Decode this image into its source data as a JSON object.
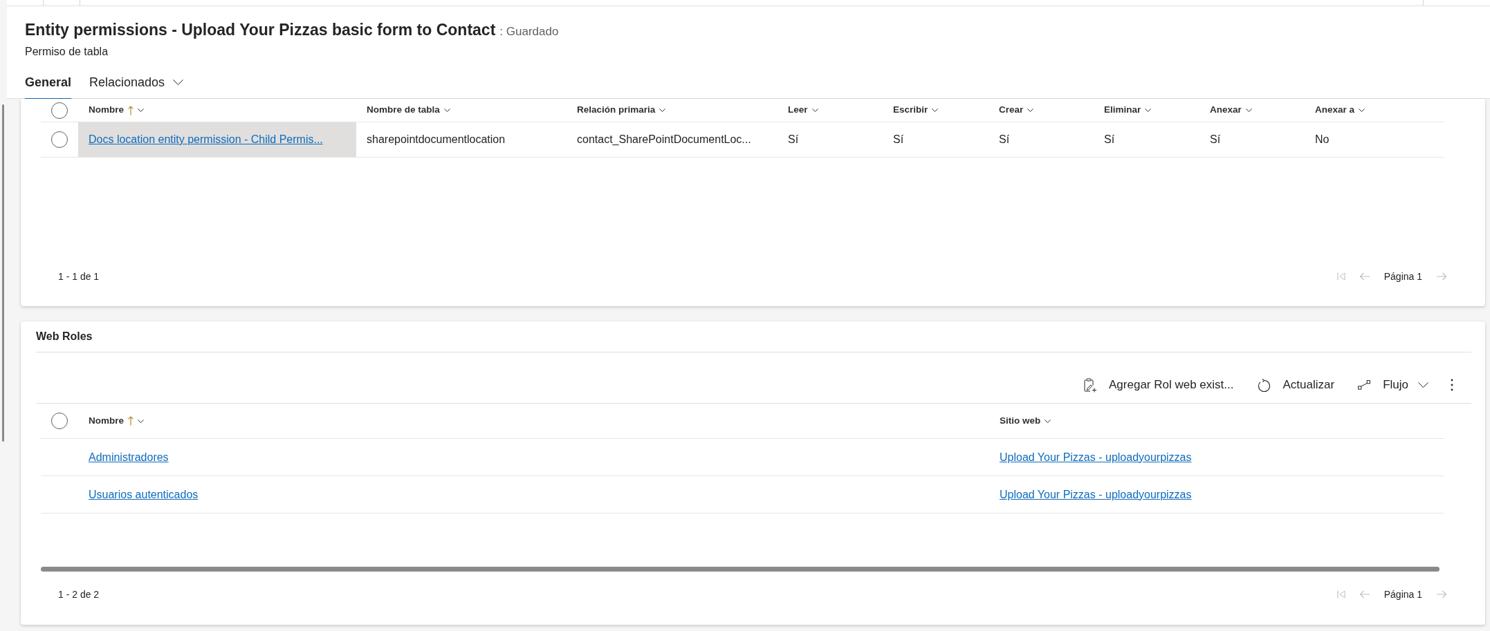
{
  "header": {
    "title": "Entity permissions - Upload Your Pizzas basic form to Contact",
    "status": ": Guardado",
    "subtitle": "Permiso de tabla"
  },
  "tabs": [
    {
      "label": "General",
      "selected": true,
      "dropdown": false
    },
    {
      "label": "Relacionados",
      "selected": false,
      "dropdown": true
    }
  ],
  "permissions_grid": {
    "all_selected": false,
    "columns": [
      {
        "label": "Nombre",
        "sorted": true,
        "link": true
      },
      {
        "label": "Nombre de tabla",
        "sorted": false,
        "link": false
      },
      {
        "label": "Relación primaria",
        "sorted": false,
        "link": false
      },
      {
        "label": "Leer",
        "sorted": false,
        "link": false
      },
      {
        "label": "Escribir",
        "sorted": false,
        "link": false
      },
      {
        "label": "Crear",
        "sorted": false,
        "link": false
      },
      {
        "label": "Eliminar",
        "sorted": false,
        "link": false
      },
      {
        "label": "Anexar",
        "sorted": false,
        "link": false
      },
      {
        "label": "Anexar a",
        "sorted": false,
        "link": false
      }
    ],
    "rows": [
      {
        "selected": false,
        "hovered": true,
        "cells": [
          "Docs location entity permission - Child Permis...",
          "sharepointdocumentlocation",
          "contact_SharePointDocumentLoc...",
          "Sí",
          "Sí",
          "Sí",
          "Sí",
          "Sí",
          "No"
        ]
      }
    ],
    "pagination": {
      "range": "1 - 1 de 1",
      "page": "Página 1",
      "first_disabled": true,
      "previous_disabled": true,
      "next_disabled": true
    }
  },
  "web_roles": {
    "title": "Web Roles",
    "toolbar": [
      {
        "kind": "add",
        "label": "Agregar Rol web exist...",
        "dropdown": false
      },
      {
        "kind": "refresh",
        "label": "Actualizar",
        "dropdown": false
      },
      {
        "kind": "flow",
        "label": "Flujo",
        "dropdown": true
      },
      {
        "kind": "more"
      }
    ],
    "all_selected": false,
    "columns": [
      {
        "label": "Nombre",
        "sorted": true,
        "link": true
      },
      {
        "label": "Sitio web",
        "sorted": false,
        "link": true
      }
    ],
    "rows": [
      {
        "selected": false,
        "hovered": false,
        "cells": [
          "Administradores",
          "Upload Your Pizzas - uploadyourpizzas"
        ]
      },
      {
        "selected": false,
        "hovered": false,
        "cells": [
          "Usuarios autenticados",
          "Upload Your Pizzas - uploadyourpizzas"
        ]
      }
    ],
    "pagination": {
      "range": "1 - 2 de 2",
      "page": "Página 1",
      "first_disabled": true,
      "previous_disabled": true,
      "next_disabled": true
    }
  }
}
